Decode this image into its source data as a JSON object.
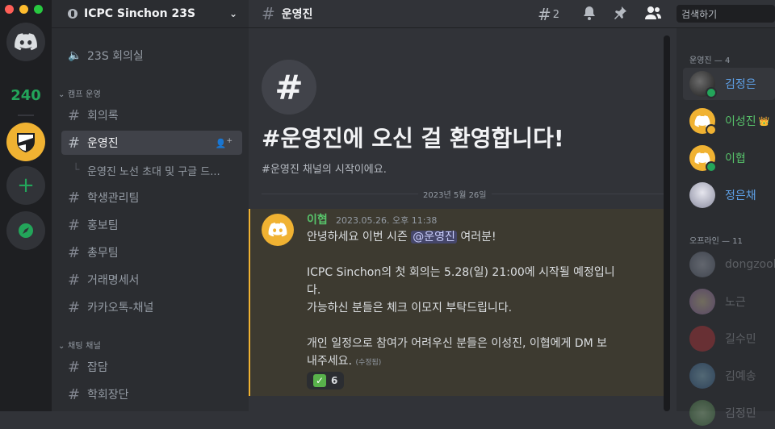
{
  "server_rail": {
    "badge_count": "240",
    "window_controls": {
      "close": "#ff5f57",
      "minimize": "#febc2e",
      "maximize": "#28c840"
    }
  },
  "guild": {
    "name": "ICPC Sinchon 23S",
    "voice_channel": "23S 회의실",
    "categories": [
      {
        "name": "캠프 운영",
        "channels": [
          "회의록",
          "운영진",
          "운영진 노선 초대 및 구글 드...",
          "학생관리팀",
          "홍보팀",
          "총무팀",
          "거래명세서",
          "카카오톡-채널"
        ]
      },
      {
        "name": "채팅 채널",
        "channels": [
          "잡담",
          "학회장단"
        ]
      }
    ]
  },
  "topbar": {
    "channel_name": "운영진",
    "threads_count": "2",
    "search_placeholder": "검색하기"
  },
  "welcome": {
    "hash_symbol": "#",
    "title": "#운영진에 오신 걸 환영합니다!",
    "subtitle": "#운영진 채널의 시작이에요."
  },
  "date_divider": "2023년 5월 26일",
  "message": {
    "author": "이협",
    "timestamp": "2023.05.26. 오후 11:38",
    "line1_prefix": "안녕하세요 이번 시즌 ",
    "mention": "@운영진",
    "line1_suffix": " 여러분!",
    "line2": "ICPC Sinchon의 첫 회의는 5.28(일) 21:00에 시작될 예정입니",
    "line3": "다.",
    "line4": "가능하신 분들은 체크 이모지 부탁드립니다.",
    "line5": "개인 일정으로 참여가 어려우신 분들은 이성진, 이협에게 DM 보",
    "line6": "내주세요.",
    "edited": "(수정됨)",
    "reaction_emoji": "✅",
    "reaction_count": "6",
    "accent_color": "#f0b232"
  },
  "members": {
    "online_header": "운영진 — 4",
    "online": [
      {
        "name": "김정은",
        "color": "#5ea0e6"
      },
      {
        "name": "이성진",
        "color": "#57c26a",
        "crown": "👑"
      },
      {
        "name": "이협",
        "color": "#57c26a"
      },
      {
        "name": "정은채",
        "color": "#5ea0e6"
      }
    ],
    "offline_header": "오프라인 — 11",
    "offline": [
      {
        "name": "dongzool"
      },
      {
        "name": "노근"
      },
      {
        "name": "길수민"
      },
      {
        "name": "김예송"
      },
      {
        "name": "김정민"
      }
    ]
  }
}
